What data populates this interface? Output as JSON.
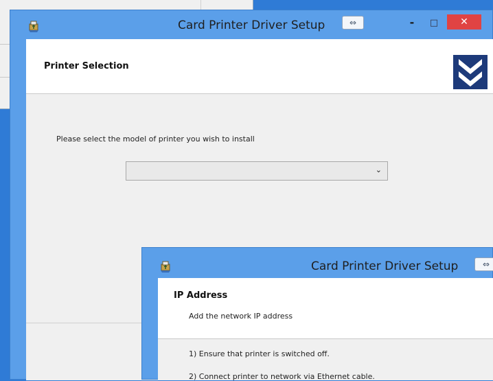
{
  "background_window": {},
  "main_window": {
    "title": "Card Printer Driver Setup",
    "controls": {
      "restore": "⇔",
      "minimize": "-",
      "maximize": "□",
      "close": "✕"
    },
    "header": {
      "title": "Printer Selection"
    },
    "content": {
      "prompt": "Please select the model of printer you wish to install",
      "model_select": {
        "value": "",
        "chevron": "⌄"
      }
    }
  },
  "ip_window": {
    "title": "Card Printer Driver Setup",
    "restore": "⇔",
    "header": {
      "title": "IP Address",
      "subtitle": "Add the network IP address"
    },
    "steps": [
      "1) Ensure that printer is switched off.",
      "2) Connect printer to network via Ethernet cable."
    ]
  },
  "colors": {
    "desktop": "#2f7bd6",
    "frame": "#5b9fe9",
    "close": "#e04343",
    "logo": "#173472"
  },
  "icons": [
    "app-icon",
    "chevron-logo-icon",
    "dropdown-chevron-icon",
    "restore-icon",
    "close-icon"
  ]
}
